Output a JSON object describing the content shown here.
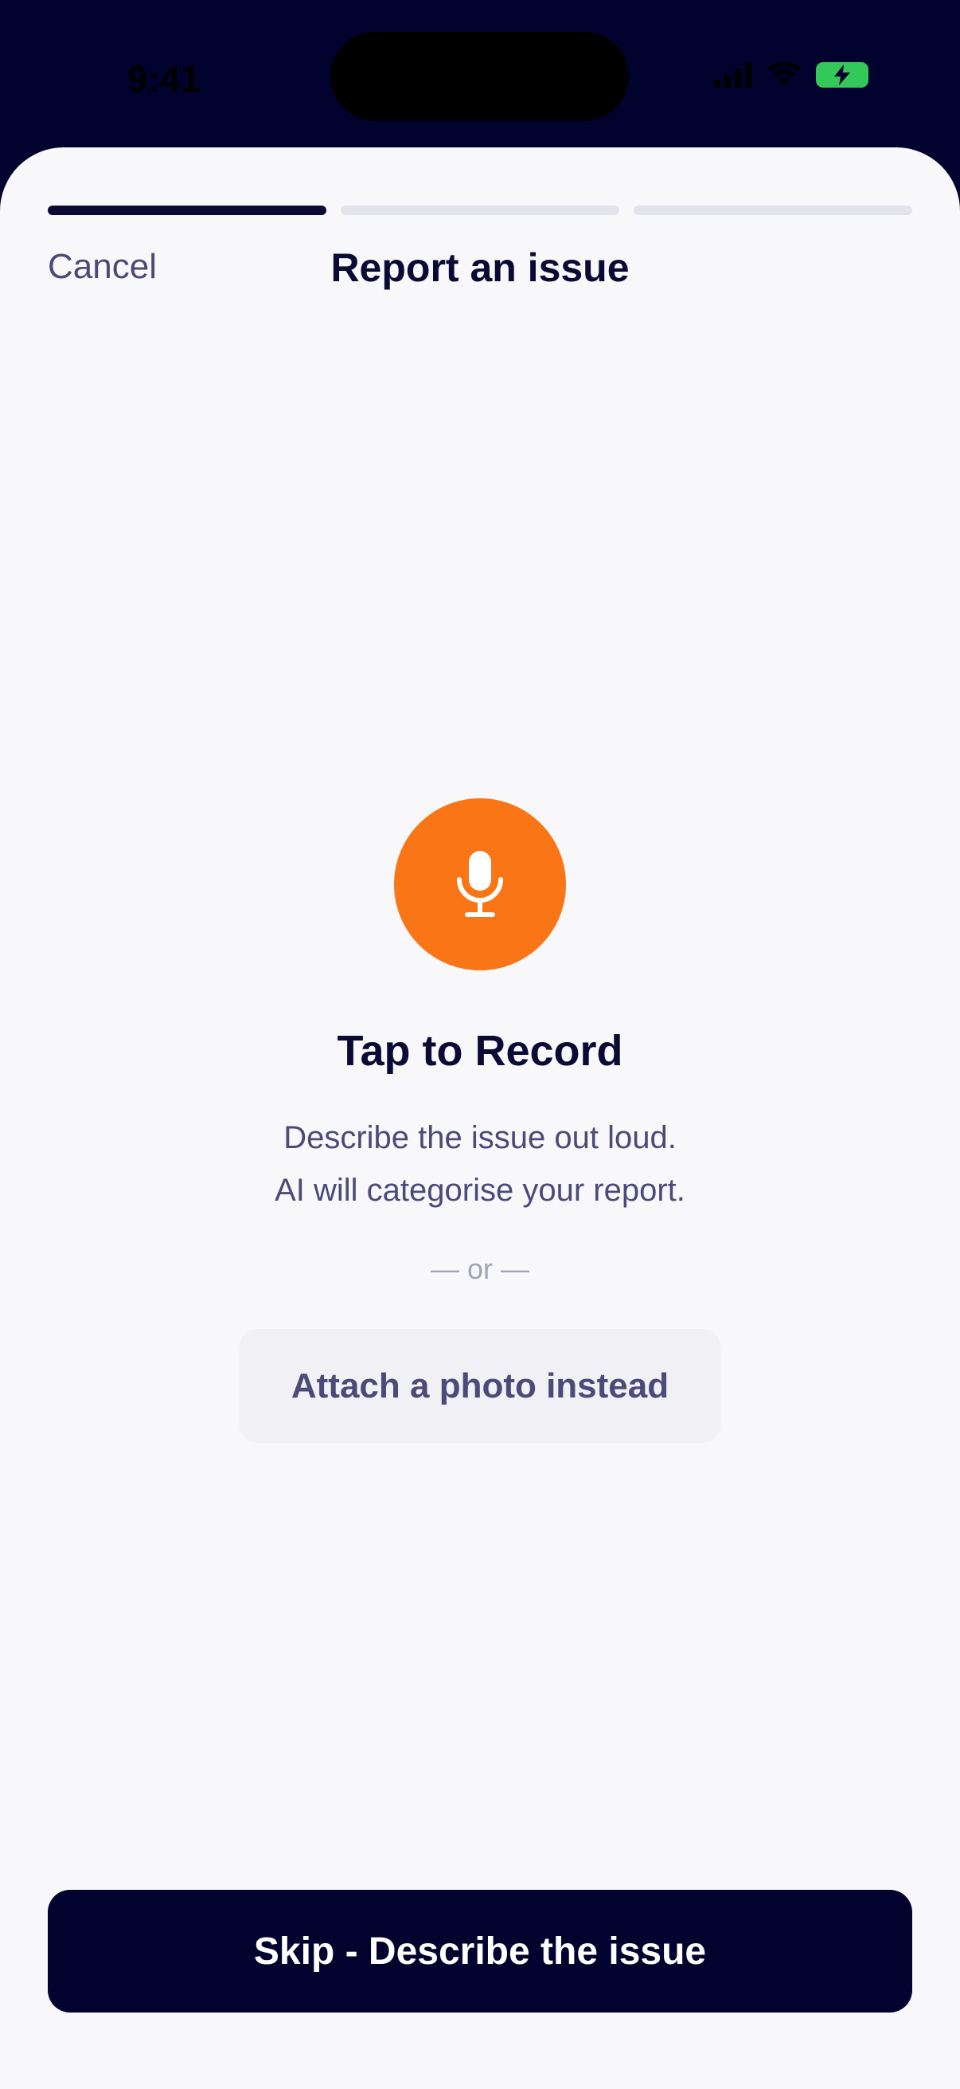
{
  "status_bar": {
    "time": "9:41"
  },
  "header": {
    "cancel_label": "Cancel",
    "title": "Report an issue",
    "progress": {
      "total_steps": 3,
      "current_step": 1
    }
  },
  "main": {
    "mic_icon": "microphone-icon",
    "record_title": "Tap to Record",
    "description_line1": "Describe the issue out loud.",
    "description_line2": "AI will categorise your report.",
    "or_divider": "— or —",
    "attach_label": "Attach a photo instead"
  },
  "footer": {
    "skip_label": "Skip - Describe the issue"
  },
  "colors": {
    "accent_orange": "#f97516",
    "navy": "#02022e",
    "battery_green": "#34c759"
  }
}
